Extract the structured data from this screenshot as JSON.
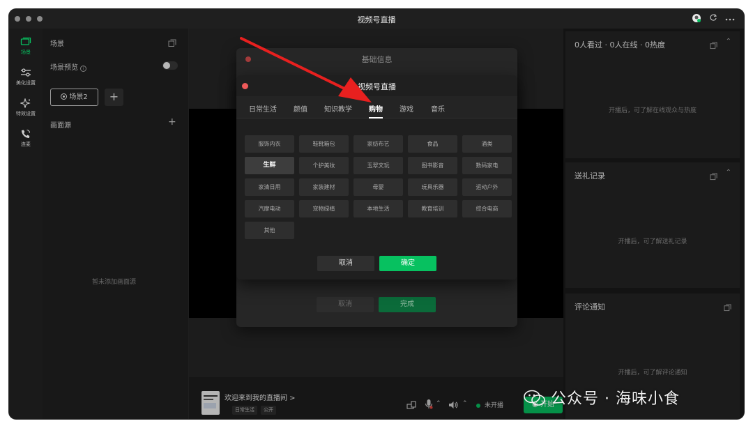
{
  "window": {
    "title": "视频号直播"
  },
  "nav": {
    "items": [
      {
        "label": "场景",
        "icon": "scene-icon"
      },
      {
        "label": "美化设置",
        "icon": "sliders-icon"
      },
      {
        "label": "特效设置",
        "icon": "sparkle-icon"
      },
      {
        "label": "连麦",
        "icon": "phone-icon"
      }
    ]
  },
  "scene_panel": {
    "title": "场景",
    "preview_label": "场景预览",
    "preview_toggle": "off",
    "scene_button": "场景2",
    "source_title": "画面源",
    "empty_text": "暂未添加画面源"
  },
  "right_panel": {
    "stats_title": "0人看过 · 0人在线 · 0热度",
    "stats_empty": "开播后，可了解在线观众与热度",
    "gifts_title": "送礼记录",
    "gifts_empty": "开播后，可了解送礼记录",
    "comments_title": "评论通知",
    "comments_empty": "开播后，可了解评论通知"
  },
  "bottom_bar": {
    "room_title": "欢迎来到我的直播间 >",
    "tag_category": "日常生活",
    "tag_visibility": "公开",
    "live_status": "未开播",
    "start_label": "开始"
  },
  "back_dialog": {
    "title": "基础信息",
    "cancel": "取消",
    "done": "完成"
  },
  "dialog": {
    "title": "视频号直播",
    "tabs": [
      "日常生活",
      "颜值",
      "知识教学",
      "购物",
      "游戏",
      "音乐"
    ],
    "active_tab": "购物",
    "categories": [
      "服饰内衣",
      "鞋靴箱包",
      "家纺布艺",
      "食品",
      "酒类",
      "生鲜",
      "个护美妆",
      "玉翠文玩",
      "图书影音",
      "数码家电",
      "家清日用",
      "家装建材",
      "母婴",
      "玩具乐器",
      "运动户外",
      "汽摩电动",
      "宠物绿植",
      "本地生活",
      "教育培训",
      "综合电商",
      "其他"
    ],
    "selected_category": "生鲜",
    "cancel": "取消",
    "confirm": "确定"
  },
  "watermark": {
    "text": "公众号 · 海味小食"
  },
  "colors": {
    "accent": "#07c160",
    "arrow": "#e8201f"
  }
}
